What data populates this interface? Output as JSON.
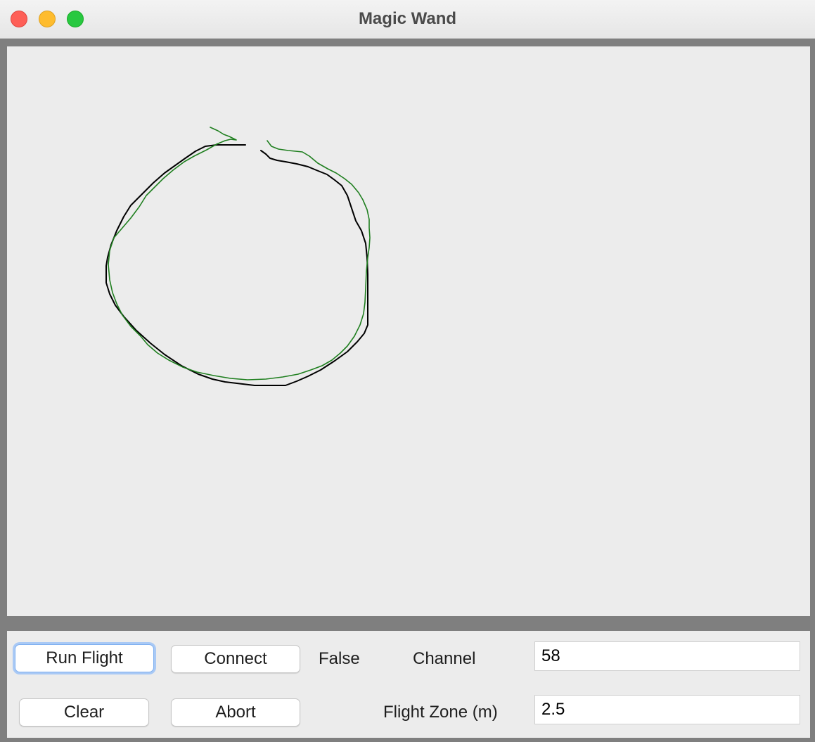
{
  "window": {
    "title": "Magic Wand"
  },
  "canvas": {
    "background": "#ececec",
    "paths": [
      {
        "name": "drawn-path",
        "color": "#000000"
      },
      {
        "name": "flight-path",
        "color": "#1f7f1f"
      }
    ]
  },
  "controls": {
    "run_flight_label": "Run Flight",
    "connect_label": "Connect",
    "connection_status": "False",
    "channel_label": "Channel",
    "channel_value": "58",
    "clear_label": "Clear",
    "abort_label": "Abort",
    "flight_zone_label": "Flight Zone (m)",
    "flight_zone_value": "2.5"
  }
}
